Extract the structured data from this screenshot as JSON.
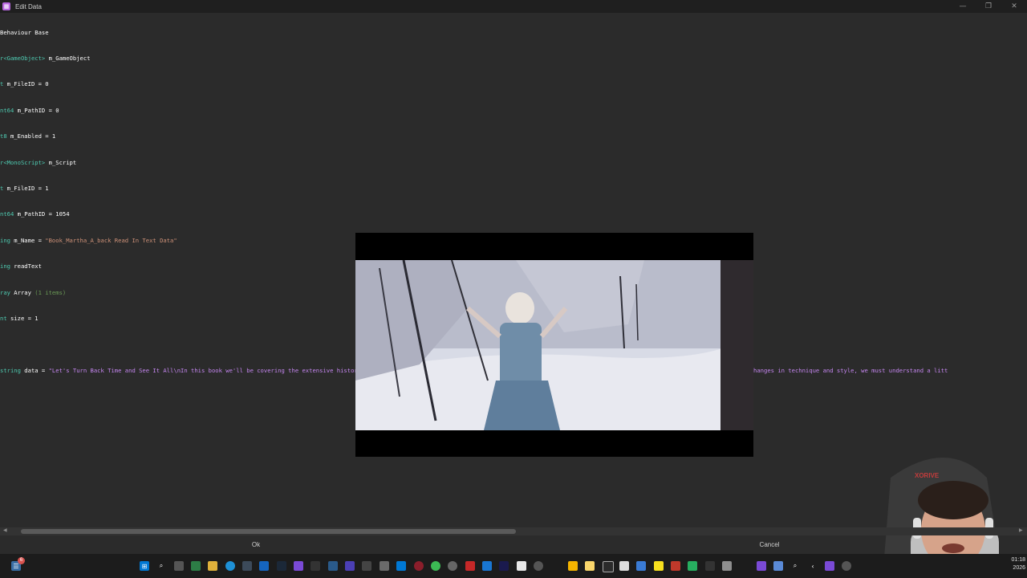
{
  "window": {
    "title": "Edit Data",
    "controls": [
      "—",
      "❐",
      "✕"
    ]
  },
  "editor": {
    "lines": [
      {
        "prefix": "",
        "name": "Behaviour Base",
        "rest": ""
      },
      {
        "prefix": "r<GameObject>",
        "name": " m_GameObject",
        "rest": ""
      },
      {
        "prefix": "t",
        "name": " m_FileID = 0",
        "rest": ""
      },
      {
        "prefix": "nt64",
        "name": " m_PathID = 0",
        "rest": ""
      },
      {
        "prefix": "t8",
        "name": " m_Enabled = 1",
        "rest": ""
      },
      {
        "prefix": "r<MonoScript>",
        "name": " m_Script",
        "rest": ""
      },
      {
        "prefix": "t",
        "name": " m_FileID = 1",
        "rest": ""
      },
      {
        "prefix": "nt64",
        "name": " m_PathID = 1054",
        "rest": ""
      },
      {
        "prefix": "ing",
        "name": " m_Name = ",
        "rest": "\"Book_Martha_A_back Read In Text Data\""
      },
      {
        "prefix": "ing",
        "name": " readText",
        "rest": ""
      },
      {
        "prefix": "ray",
        "name": " Array ",
        "rest": "(1 items)"
      },
      {
        "prefix": "nt",
        "name": " size = 1",
        "rest": ""
      },
      {
        "prefix": "",
        "name": "",
        "rest": ""
      },
      {
        "prefix": "string",
        "name": " data = ",
        "rest": "\"Let's Turn Back Time and See It All\\nIn this book we'll be covering the extensive history of North American Pottery.\\nPettery has changed as much as the landscape and the people. To understand certain changes in technique and style, we must understand a litt"
      }
    ]
  },
  "buttons": {
    "ok": "Ok",
    "cancel": "Cancel"
  },
  "clock": {
    "time": "01:18",
    "date": "2026"
  },
  "notification_badge": "6",
  "webcam_chair_brand": "XORIVE",
  "taskbar_icons": [
    "windows-start",
    "search",
    "task-view",
    "widgets",
    "file-explorer",
    "edge",
    "store",
    "mail",
    "steam",
    "app-purple",
    "vscode",
    "recording",
    "chrome",
    "settings",
    "app-red",
    "app-blue",
    "app-ae",
    "app-white",
    "app-yellow",
    "app-notes",
    "app-terminal",
    "app-blue2",
    "app-green",
    "app-pdf",
    "app-misc",
    "app-dark",
    "app-purple2",
    "app-tray"
  ],
  "colors": {
    "background": "#2b2b2b",
    "titlebar": "#1f1f1f",
    "taskbar": "#1c1c1c",
    "keyword_type": "#4ec9b0",
    "string": "#ce9178",
    "comment": "#6a9955",
    "data_string": "#c586f0"
  }
}
